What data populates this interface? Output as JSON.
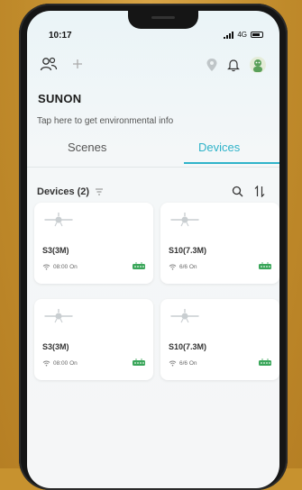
{
  "status_bar": {
    "time": "10:17",
    "network": "4G"
  },
  "app": {
    "brand": "SUNON",
    "env_info": "Tap here to get environmental info"
  },
  "tabs": [
    {
      "label": "Scenes",
      "active": false
    },
    {
      "label": "Devices",
      "active": true
    }
  ],
  "devices_section": {
    "title": "Devices (2)"
  },
  "devices": [
    {
      "name": "S3(3M)",
      "status": "08:00 On"
    },
    {
      "name": "S10(7.3M)",
      "status": "6/6 On"
    },
    {
      "name": "S3(3M)",
      "status": "08:00 On"
    },
    {
      "name": "S10(7.3M)",
      "status": "6/6 On"
    }
  ],
  "colors": {
    "accent": "#2fb3c9",
    "gateway_green": "#3aa65a",
    "background": "#c7922f"
  }
}
